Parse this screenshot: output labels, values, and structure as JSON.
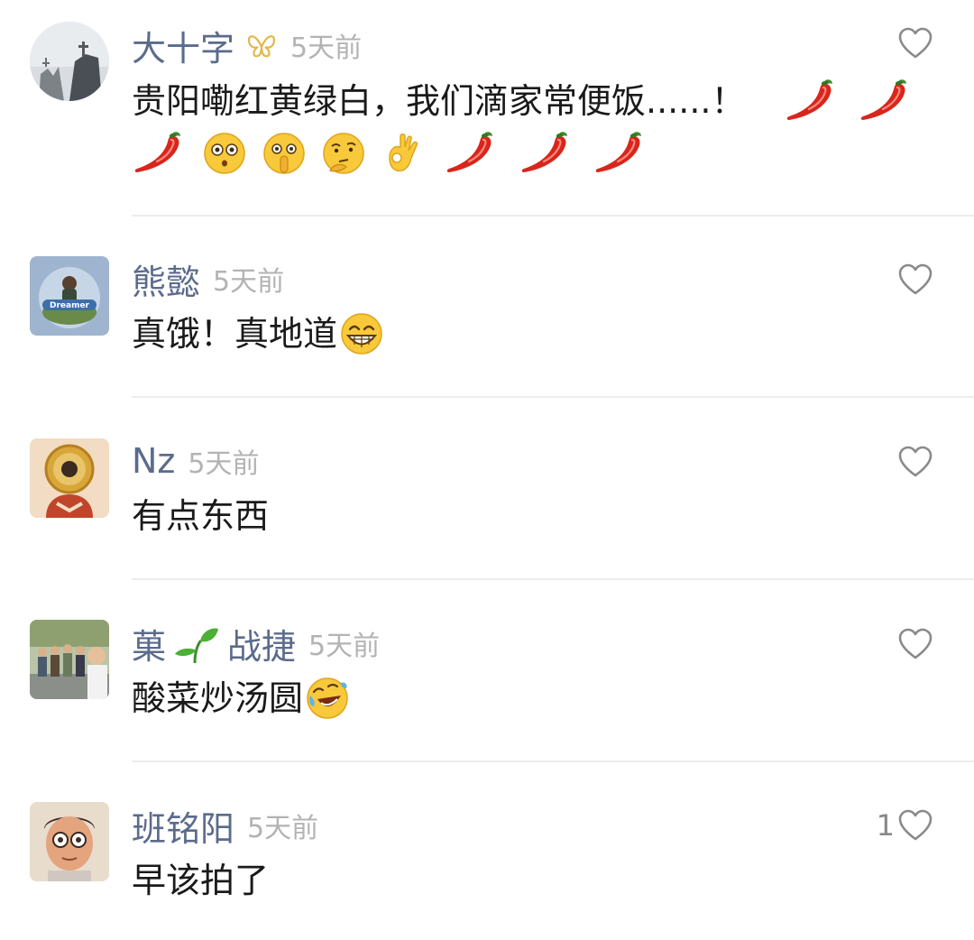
{
  "colors": {
    "name": "#5b6b8c",
    "timestamp": "#b3b3b3",
    "text": "#1a1a1a",
    "divider": "#ececec",
    "heart_outline": "#8a8a8a"
  },
  "comments": [
    {
      "name": "大十字",
      "badge_icon": "butterfly-badge-icon",
      "time": "5天前",
      "text_main": "贵阳嘞红黄绿白，我们滴家常便饭......！",
      "emojis_line1": [
        "chili-pepper-icon",
        "chili-pepper-icon"
      ],
      "emojis_line2": [
        "chili-pepper-icon",
        "flushed-face-icon",
        "shushing-face-icon",
        "thinking-face-icon",
        "ok-hand-icon",
        "chili-pepper-icon",
        "chili-pepper-icon",
        "chili-pepper-icon"
      ],
      "like_icon": "heart-outline-icon"
    },
    {
      "name": "熊懿",
      "time": "5天前",
      "text_main": "真饿！真地道",
      "emoji": "grinning-face-icon",
      "avatar_text": "Dreamer",
      "like_icon": "heart-outline-icon"
    },
    {
      "name": "Nz",
      "time": "5天前",
      "text_main": "有点东西",
      "like_icon": "heart-outline-icon"
    },
    {
      "name_part1": "菓",
      "name_icon": "seedling-icon",
      "name_part2": "战捷",
      "time": "5天前",
      "text_main": "酸菜炒汤圆",
      "emoji": "rolling-on-floor-laughing-icon",
      "like_icon": "heart-outline-icon"
    },
    {
      "name": "班铭阳",
      "time": "5天前",
      "text_main": "早该拍了",
      "like_count": "1",
      "like_icon": "heart-outline-icon"
    }
  ]
}
